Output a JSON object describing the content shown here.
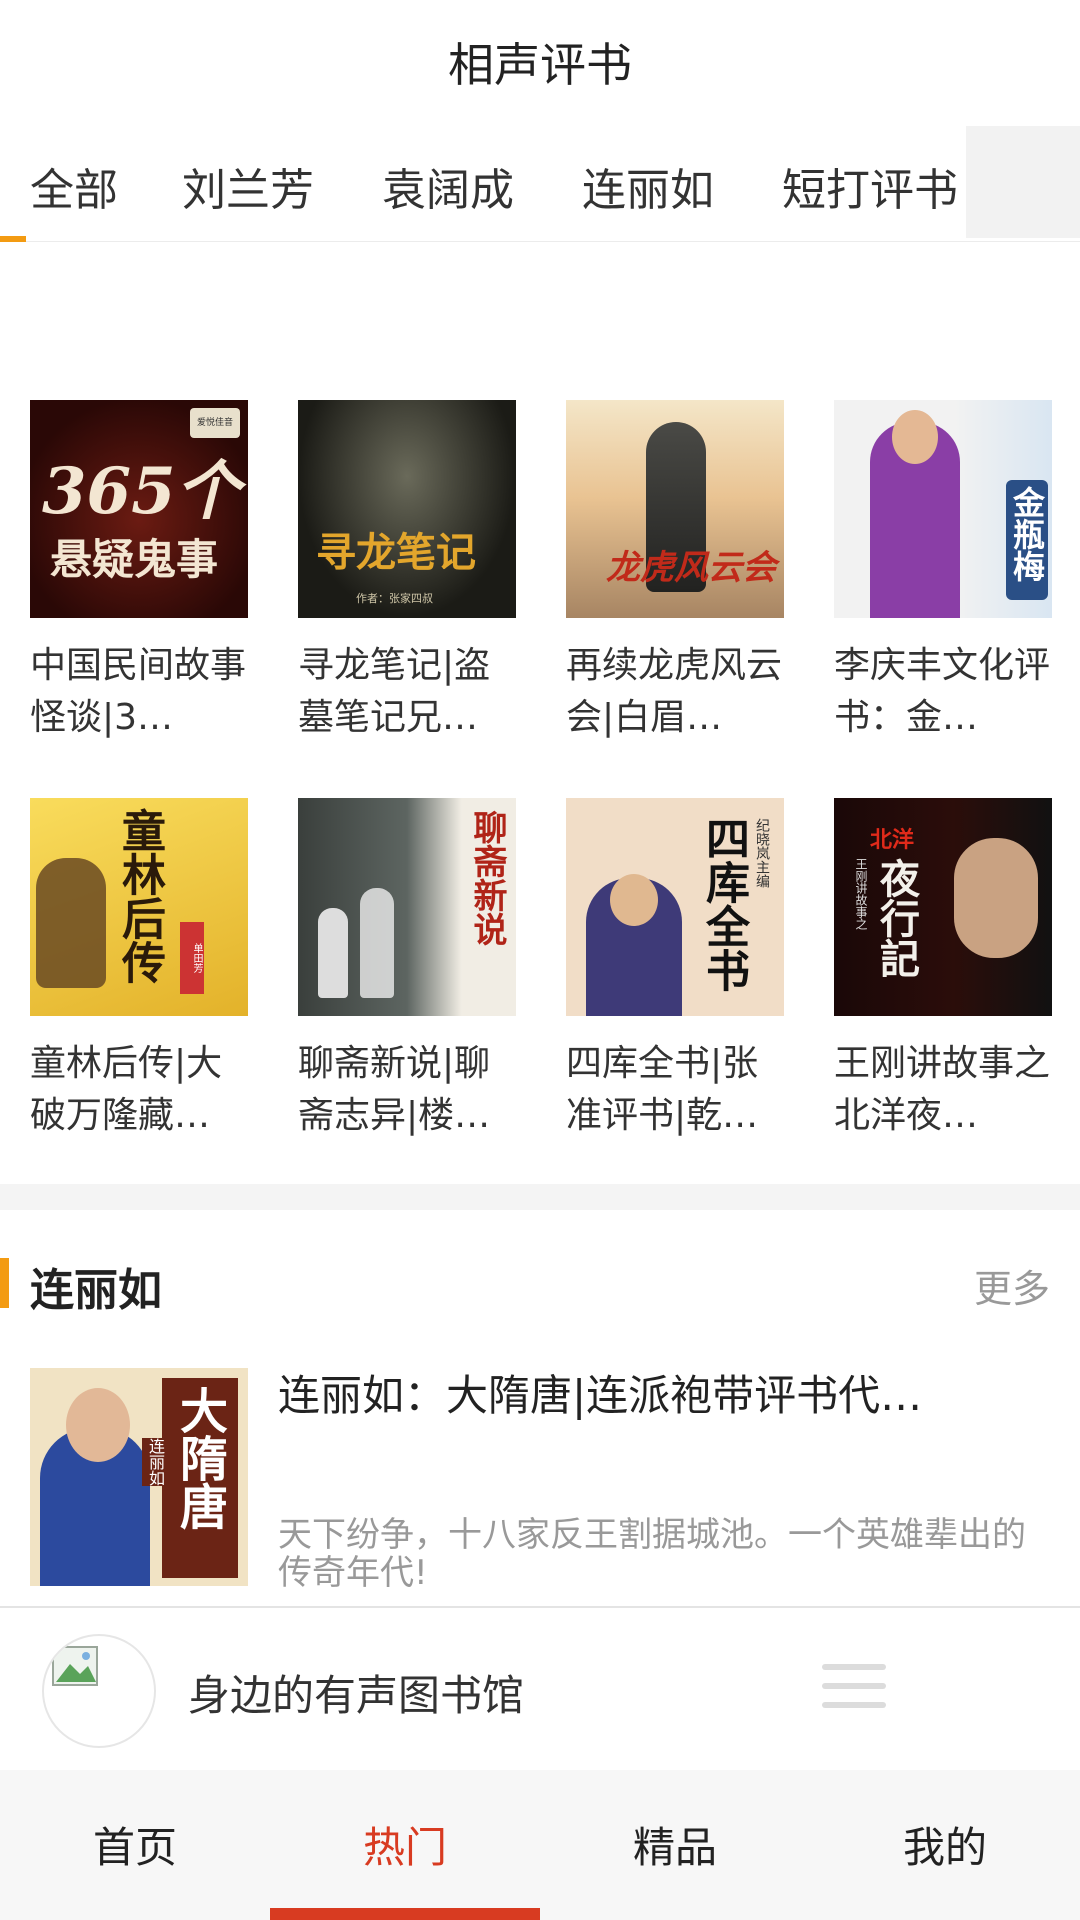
{
  "header": {
    "title": "相声评书"
  },
  "tabs": [
    {
      "label": "全部",
      "active": true
    },
    {
      "label": "刘兰芳"
    },
    {
      "label": "袁阔成"
    },
    {
      "label": "连丽如"
    },
    {
      "label": "短打评书"
    }
  ],
  "grid": [
    {
      "title": "中国民间故事怪谈|3…",
      "cover_text": [
        "365个",
        "悬疑鬼事"
      ],
      "cover_badge": "爱悦佳音"
    },
    {
      "title": "寻龙笔记|盗墓笔记兄…",
      "cover_text": [
        "寻龙笔记",
        "作者：张家四叔"
      ]
    },
    {
      "title": "再续龙虎风云会|白眉…",
      "cover_text": [
        "龙虎风云会"
      ]
    },
    {
      "title": "李庆丰文化评书：金…",
      "cover_text": [
        "金瓶梅"
      ]
    },
    {
      "title": "童林后传|大破万隆藏…",
      "cover_text": [
        "童林后传",
        "单田芳"
      ]
    },
    {
      "title": "聊斋新说|聊斋志异|楼…",
      "cover_text": [
        "聊斋新说"
      ]
    },
    {
      "title": "四库全书|张准评书|乾…",
      "cover_text": [
        "四库全书",
        "纪晓岚主编"
      ]
    },
    {
      "title": "王刚讲故事之北洋夜…",
      "cover_text": [
        "北洋",
        "夜行記",
        "王刚讲故事之"
      ]
    }
  ],
  "section": {
    "title": "连丽如",
    "more": "更多",
    "feature": {
      "title": "连丽如：大隋唐|连派袍带评书代…",
      "desc": "天下纷争，十八家反王割据城池。一个英雄辈出的传奇年代!",
      "cover_text": [
        "大隋唐",
        "连丽如"
      ]
    }
  },
  "player": {
    "text": "身边的有声图书馆"
  },
  "bottom_nav": [
    {
      "label": "首页"
    },
    {
      "label": "热门",
      "active": true
    },
    {
      "label": "精品"
    },
    {
      "label": "我的"
    }
  ],
  "colors": {
    "accent": "#f39b12",
    "active_red": "#d83b21"
  }
}
